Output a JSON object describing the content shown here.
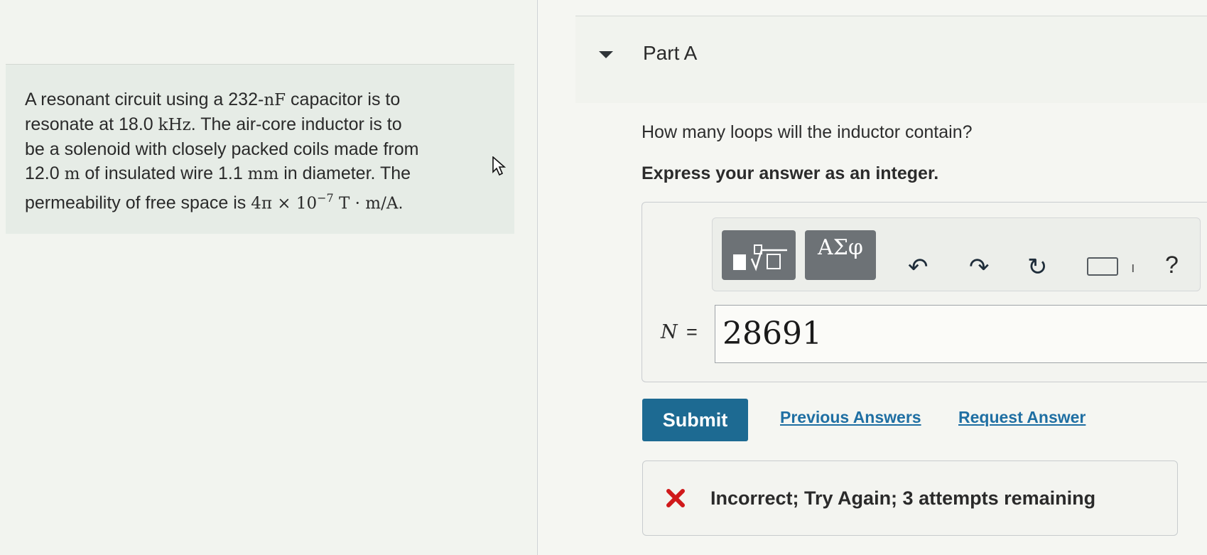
{
  "problem": {
    "seg1": "A resonant circuit using a 232-",
    "u_nF": "nF",
    "seg2": " capacitor is to",
    "seg3": "resonate at 18.0 ",
    "u_kHz": "kHz",
    "seg4": ". The air-core inductor is to",
    "seg5": "be a solenoid with closely packed coils made from",
    "seg6": "12.0 ",
    "u_m": "m",
    "seg7": " of insulated wire 1.1 ",
    "u_mm": "mm",
    "seg8": " in diameter. The",
    "seg9": "permeability of free space is ",
    "mu_expr": "4π × 10",
    "mu_exp": "−7",
    "mu_units": " T · m/A",
    "seg10": "."
  },
  "part": {
    "title": "Part A",
    "question": "How many loops will the inductor contain?",
    "instruction": "Express your answer as an integer."
  },
  "toolbar": {
    "greek_label": "ΑΣφ",
    "undo_glyph": "↶",
    "redo_glyph": "↷",
    "reset_glyph": "↻",
    "kbd_suffix": "ı",
    "help_glyph": "?"
  },
  "answer": {
    "variable": "N",
    "equals": "=",
    "value": "28691"
  },
  "actions": {
    "submit": "Submit",
    "previous": "Previous Answers",
    "request": "Request Answer"
  },
  "feedback": {
    "message": "Incorrect; Try Again; 3 attempts remaining",
    "color": "#d0191b"
  },
  "colors": {
    "accent": "#1d6a92",
    "link": "#1f6fa3"
  }
}
